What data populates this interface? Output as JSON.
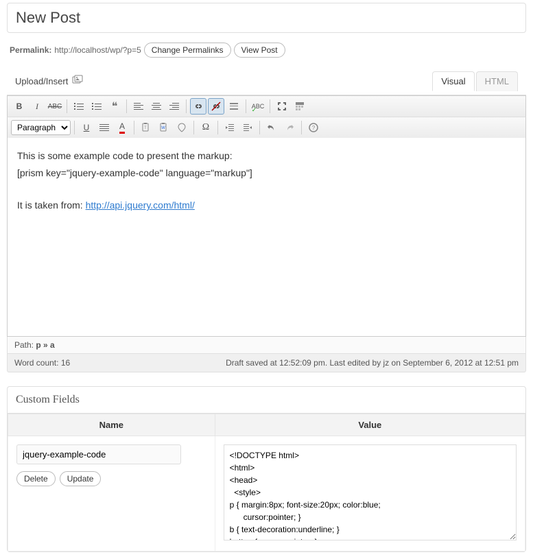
{
  "header": {
    "title": "New Post"
  },
  "permalink": {
    "label": "Permalink:",
    "url": "http://localhost/wp/?p=5",
    "change_btn": "Change Permalinks",
    "view_btn": "View Post"
  },
  "upload": {
    "label": "Upload/Insert"
  },
  "tabs": {
    "visual": "Visual",
    "html": "HTML"
  },
  "toolbar": {
    "format_select": "Paragraph"
  },
  "editor": {
    "line1": "This is some example code to present the markup:",
    "line2": "[prism key=\"jquery-example-code\" language=\"markup\"]",
    "line3_prefix": "It is taken from: ",
    "line3_link": "http://api.jquery.com/html/"
  },
  "path": {
    "label": "Path:",
    "value": "p » a"
  },
  "status": {
    "wordcount_label": "Word count:",
    "wordcount": "16",
    "save_info": "Draft saved at 12:52:09 pm. Last edited by jz on September 6, 2012 at 12:51 pm"
  },
  "custom_fields": {
    "title": "Custom Fields",
    "col_name": "Name",
    "col_value": "Value",
    "row": {
      "name": "jquery-example-code",
      "value": "<!DOCTYPE html>\n<html>\n<head>\n  <style>\np { margin:8px; font-size:20px; color:blue;\n      cursor:pointer; }\nb { text-decoration:underline; }\nbutton { cursor:pointer; }"
    },
    "delete_btn": "Delete",
    "update_btn": "Update"
  }
}
